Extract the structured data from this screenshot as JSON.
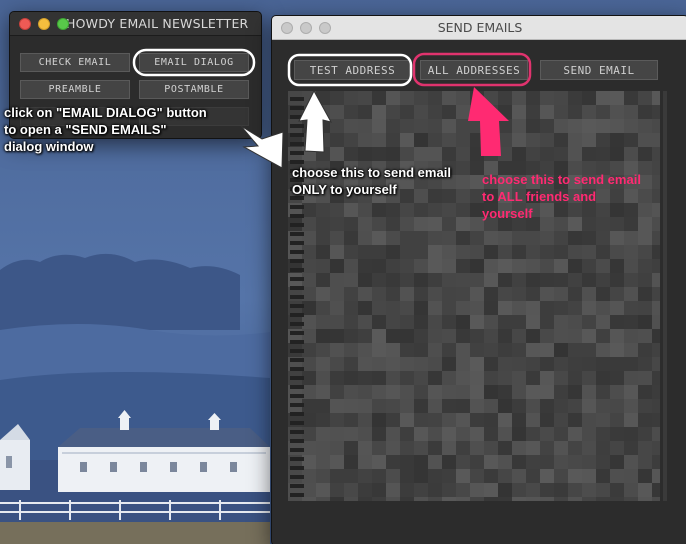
{
  "newsletter_window": {
    "title": "HOWDY EMAIL NEWSLETTER",
    "buttons": {
      "check_email": "CHECK EMAIL",
      "email_dialog": "EMAIL DIALOG",
      "preamble": "PREAMBLE",
      "postamble": "POSTAMBLE"
    }
  },
  "send_window": {
    "title": "SEND EMAILS",
    "buttons": {
      "test_address": "TEST ADDRESS",
      "all_addresses": "ALL ADDRESSES",
      "send_email": "SEND EMAIL"
    }
  },
  "annotations": {
    "email_dialog_note": "click on \"EMAIL DIALOG\" button\nto open a \"SEND EMAILS\"\ndialog window",
    "test_address_note": "choose this to send email\nONLY to yourself",
    "all_addresses_note": "choose this to send email\nto ALL friends and\nyourself"
  },
  "colors": {
    "white_highlight": "#ffffff",
    "pink_highlight": "#e0336e",
    "pink_text": "#ff2a72",
    "sky": "#3c5586",
    "window_dark": "#2c2c2c"
  },
  "icons": {
    "close": "close-icon",
    "minimize": "minimize-icon",
    "zoom": "zoom-icon",
    "arrow": "arrow-icon"
  }
}
